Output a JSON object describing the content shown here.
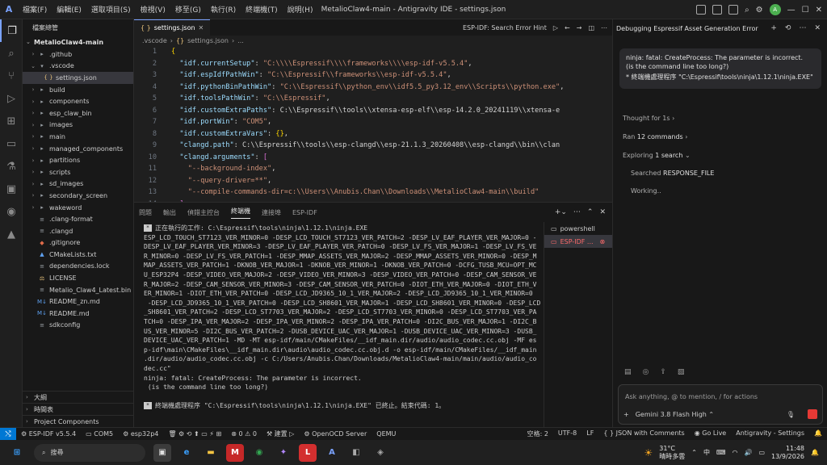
{
  "titlebar": {
    "menus": [
      "檔案(F)",
      "編輯(E)",
      "選取項目(S)",
      "檢視(V)",
      "移至(G)",
      "執行(R)",
      "終端機(T)",
      "說明(H)"
    ],
    "title": "MetalioClaw4-main - Antigravity IDE - settings.json"
  },
  "explorer": {
    "header": "檔案總管",
    "root": "MetalioClaw4-main",
    "items": [
      {
        "label": ".github",
        "type": "folder",
        "indent": 1
      },
      {
        "label": ".vscode",
        "type": "folder-open",
        "indent": 1
      },
      {
        "label": "settings.json",
        "type": "json",
        "indent": 2
      },
      {
        "label": "build",
        "type": "folder",
        "indent": 1
      },
      {
        "label": "components",
        "type": "folder",
        "indent": 1
      },
      {
        "label": "esp_claw_bin",
        "type": "folder",
        "indent": 1
      },
      {
        "label": "images",
        "type": "folder",
        "indent": 1
      },
      {
        "label": "main",
        "type": "folder",
        "indent": 1
      },
      {
        "label": "managed_components",
        "type": "folder",
        "indent": 1
      },
      {
        "label": "partitions",
        "type": "folder",
        "indent": 1
      },
      {
        "label": "scripts",
        "type": "folder",
        "indent": 1
      },
      {
        "label": "sd_images",
        "type": "folder",
        "indent": 1
      },
      {
        "label": "secondary_screen",
        "type": "folder",
        "indent": 1
      },
      {
        "label": "wakeword",
        "type": "folder",
        "indent": 1
      },
      {
        "label": ".clang-format",
        "type": "file",
        "indent": 1
      },
      {
        "label": ".clangd",
        "type": "file",
        "indent": 1
      },
      {
        "label": ".gitignore",
        "type": "git",
        "indent": 1
      },
      {
        "label": "CMakeLists.txt",
        "type": "cmake",
        "indent": 1
      },
      {
        "label": "dependencies.lock",
        "type": "file",
        "indent": 1
      },
      {
        "label": "LICENSE",
        "type": "license",
        "indent": 1
      },
      {
        "label": "Metalio_Claw4_Latest.bin",
        "type": "file",
        "indent": 1
      },
      {
        "label": "README_zn.md",
        "type": "md",
        "indent": 1
      },
      {
        "label": "README.md",
        "type": "md",
        "indent": 1
      },
      {
        "label": "sdkconfig",
        "type": "file",
        "indent": 1
      }
    ],
    "bottom_sections": [
      "大綱",
      "時間表",
      "Project Components"
    ]
  },
  "editor": {
    "tab_label": "settings.json",
    "tab_right_label": "ESP-IDF: Search Error Hint",
    "breadcrumb": [
      ".vscode",
      "settings.json",
      "..."
    ],
    "lines": [
      "{",
      "  \"idf.currentSetup\": \"C:\\\\\\\\Espressif\\\\\\\\frameworks\\\\\\\\esp-idf-v5.5.4\",",
      "  \"idf.espIdfPathWin\": \"C:\\\\Espressif\\\\frameworks\\\\esp-idf-v5.5.4\",",
      "  \"idf.pythonBinPathWin\": \"C:\\\\Espressif\\\\python_env\\\\idf5.5_py3.12_env\\\\Scripts\\\\python.exe\",",
      "  \"idf.toolsPathWin\": \"C:\\\\Espressif\",",
      "  \"idf.customExtraPaths\": \"C:\\\\Espressif\\\\tools\\\\xtensa-esp-elf\\\\esp-14.2.0_20241119\\\\xtensa-e",
      "  \"idf.portWin\": \"COM5\",",
      "  \"idf.customExtraVars\": {},",
      "  \"clangd.path\": \"C:\\\\Espressif\\\\tools\\\\esp-clangd\\\\esp-21.1.3_20260408\\\\esp-clangd\\\\bin\\\\clan",
      "  \"clangd.arguments\": [",
      "    \"--background-index\",",
      "    \"--query-driver=**\",",
      "    \"--compile-commands-dir=c:\\\\Users\\\\Anubis.Chan\\\\Downloads\\\\MetalioClaw4-main\\\\build\"",
      "  ]",
      "}"
    ]
  },
  "panel": {
    "tabs": [
      "問題",
      "輸出",
      "偵錯主控台",
      "終端機",
      "連接埠",
      "ESP-IDF"
    ],
    "active_tab": "終端機",
    "terminal_lines": [
      "正在執行的工作: C:\\Espressif\\tools\\ninja\\1.12.1\\ninja.EXE",
      "ESP_LCD_TOUCH_ST7123_VER_MINOR=0 -DESP_LCD_TOUCH_ST7123_VER_PATCH=2 -DESP_LV_EAF_PLAYER_VER_MAJOR=0 -",
      "DESP_LV_EAF_PLAYER_VER_MINOR=3 -DESP_LV_EAF_PLAYER_VER_PATCH=0 -DESP_LV_FS_VER_MAJOR=1 -DESP_LV_FS_VE",
      "R_MINOR=0 -DESP_LV_FS_VER_PATCH=1 -DESP_MMAP_ASSETS_VER_MAJOR=2 -DESP_MMAP_ASSETS_VER_MINOR=0 -DESP_M",
      "MAP_ASSETS_VER_PATCH=1 -DKNOB_VER_MAJOR=1 -DKNOB_VER_MINOR=1 -DKNOB_VER_PATCH=0 -DCFG_TUSB_MCU=OPT_MC",
      "U_ESP32P4 -DESP_VIDEO_VER_MAJOR=2 -DESP_VIDEO_VER_MINOR=3 -DESP_VIDEO_VER_PATCH=0 -DESP_CAM_SENSOR_VE",
      "R_MAJOR=2 -DESP_CAM_SENSOR_VER_MINOR=3 -DESP_CAM_SENSOR_VER_PATCH=0 -DIOT_ETH_VER_MAJOR=0 -DIOT_ETH_V",
      "ER_MINOR=1 -DIOT_ETH_VER_PATCH=0 -DESP_LCD_JD9365_10_1_VER_MAJOR=2 -DESP_LCD_JD9365_10_1_VER_MINOR=0",
      " -DESP_LCD_JD9365_10_1_VER_PATCH=0 -DESP_LCD_SH8601_VER_MAJOR=1 -DESP_LCD_SH8601_VER_MINOR=0 -DESP_LCD",
      "_SH8601_VER_PATCH=2 -DESP_LCD_ST7703_VER_MAJOR=2 -DESP_LCD_ST7703_VER_MINOR=0 -DESP_LCD_ST7703_VER_PA",
      "TCH=0 -DESP_IPA_VER_MAJOR=2 -DESP_IPA_VER_MINOR=2 -DESP_IPA_VER_PATCH=0 -DI2C_BUS_VER_MAJOR=1 -DI2C_B",
      "US_VER_MINOR=5 -DI2C_BUS_VER_PATCH=2 -DUSB_DEVICE_UAC_VER_MAJOR=1 -DUSB_DEVICE_UAC_VER_MINOR=3 -DUSB_",
      "DEVICE_UAC_VER_PATCH=1 -MD -MT esp-idf/main/CMakeFiles/__idf_main.dir/audio/audio_codec.cc.obj -MF es",
      "p-idf\\main\\CMakeFiles\\__idf_main.dir\\audio\\audio_codec.cc.obj.d -o esp-idf/main/CMakeFiles/__idf_main",
      ".dir/audio/audio_codec.cc.obj -c C:/Users/Anubis.Chan/Downloads/MetalioClaw4-main/main/audio/audio_co",
      "dec.cc\"",
      "ninja: fatal: CreateProcess: The parameter is incorrect.",
      " (is the command line too long?)",
      "",
      "終端機處理程序 \"C:\\Espressif\\tools\\ninja\\1.12.1\\ninja.EXE\" 已終止。結束代碼: 1。"
    ],
    "terminals": [
      "powershell",
      "ESP-IDF ..."
    ]
  },
  "agent": {
    "title": "Debugging Espressif Asset Generation Error",
    "bubble_line1": "ninja: fatal: CreateProcess: The parameter is incorrect.",
    "bubble_line2": "(is the command line too long?)",
    "bubble_line3": "終端機處理程序 \"C:\\Espressif\\tools\\ninja\\1.12.1\\ninja.EXE\"",
    "thought": "Thought for 1s",
    "ran_prefix": "Ran ",
    "ran_count": "12 commands",
    "exploring_prefix": "Exploring ",
    "exploring_count": "1 search",
    "searched_prefix": "Searched ",
    "searched_term": "RESPONSE_FILE",
    "working": "Working..",
    "input_placeholder": "Ask anything, @ to mention, / for actions",
    "model": "Gemini 3.8 Flash High"
  },
  "statusbar": {
    "left": [
      "ESP-IDF v5.5.4",
      "COM5",
      "esp32p4",
      "",
      "0",
      "0",
      "建置",
      "OpenOCD Server",
      "QEMU"
    ],
    "right": [
      "空格: 2",
      "UTF-8",
      "LF",
      "{ } JSON with Comments",
      "Go Live",
      "Antigravity - Settings"
    ]
  },
  "taskbar": {
    "search": "搜尋",
    "weather_temp": "31°C",
    "weather_desc": "晴時多雲",
    "ime": "中",
    "time": "11:48",
    "date": "13/9/2026"
  }
}
